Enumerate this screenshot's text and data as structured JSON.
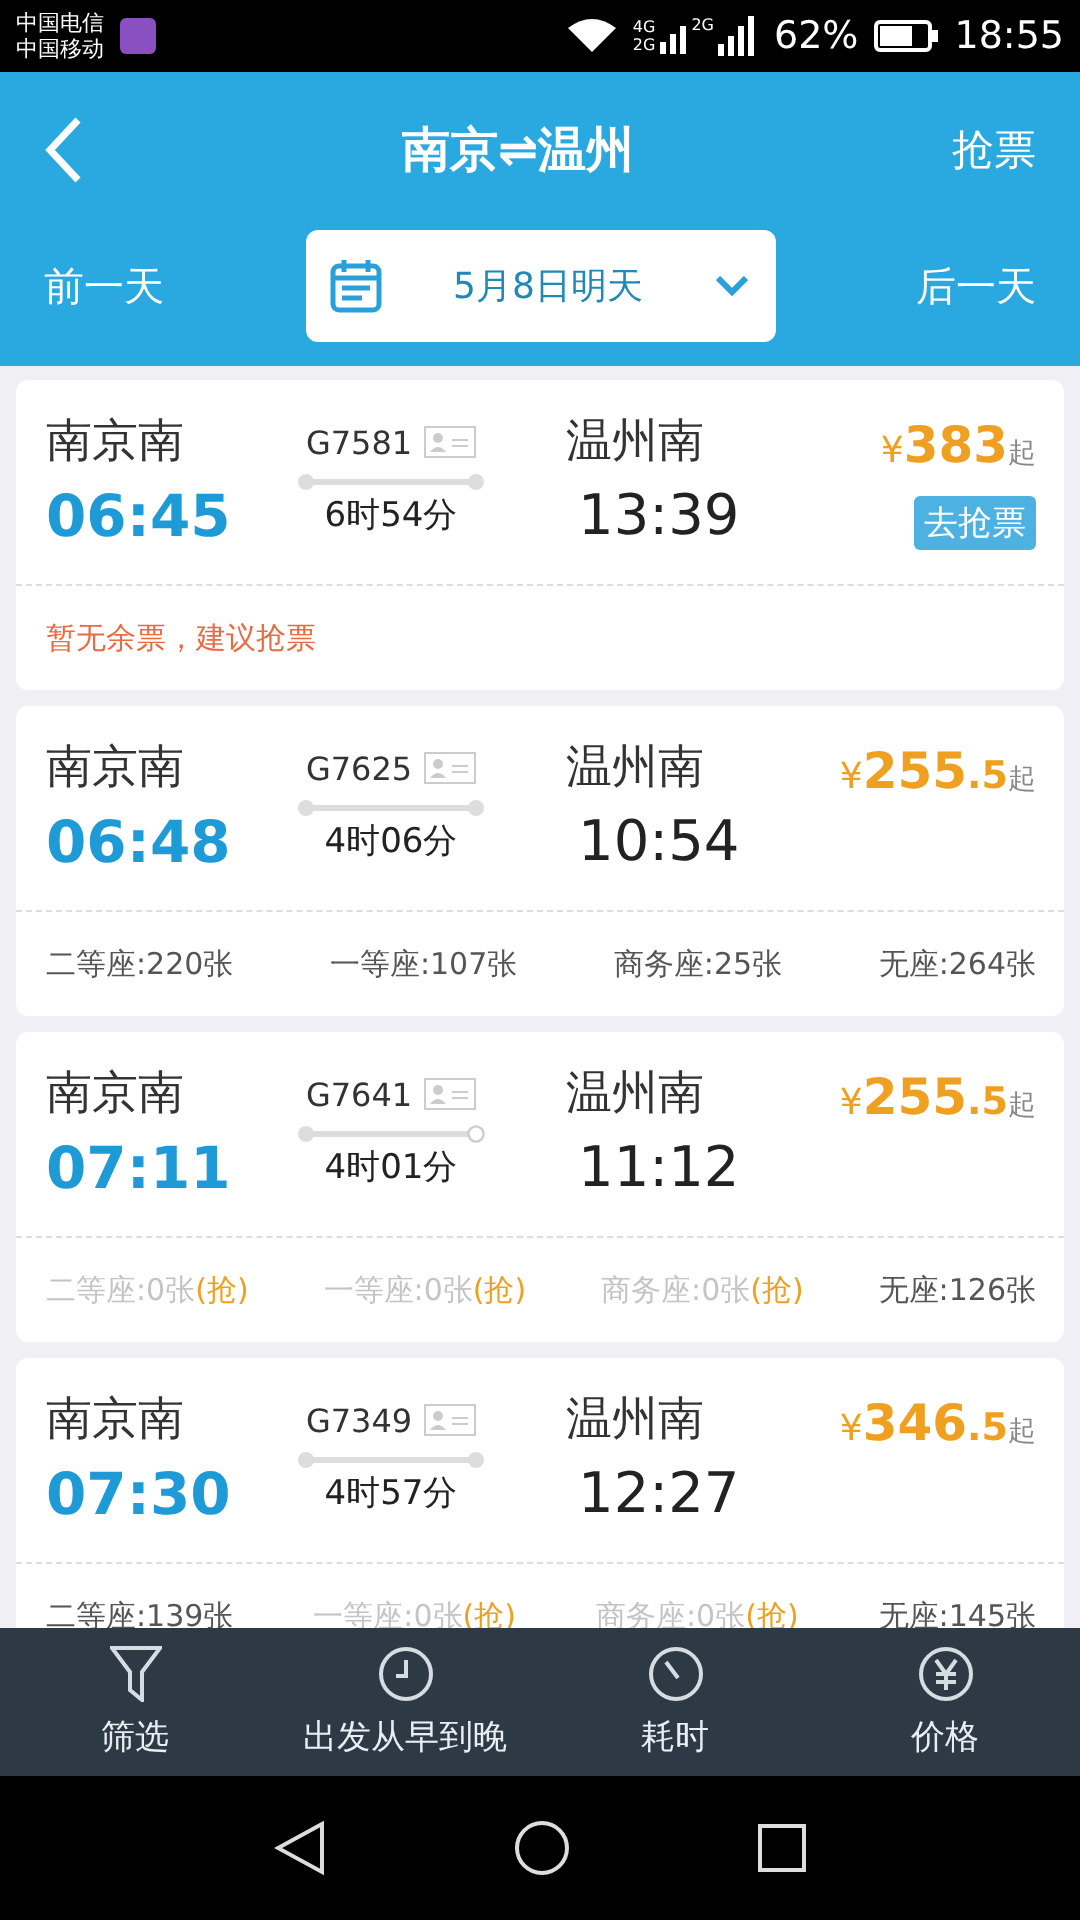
{
  "status_bar": {
    "carriers": [
      "中国电信",
      "中国移动"
    ],
    "network_labels": [
      "4G",
      "2G",
      "2G"
    ],
    "battery": "62%",
    "time": "18:55"
  },
  "header": {
    "title": "南京⇌温州",
    "action": "抢票",
    "prev_day": "前一天",
    "date": "5月8日明天",
    "next_day": "后一天"
  },
  "trains": [
    {
      "from": "南京南",
      "depart": "06:45",
      "number": "G7581",
      "duration": "6时54分",
      "to": "温州南",
      "arrive": "13:39",
      "currency": "¥",
      "price_int": "383",
      "price_suffix": "起",
      "grab_button": "去抢票",
      "notice": "暂无余票，建议抢票",
      "end_hollow": false
    },
    {
      "from": "南京南",
      "depart": "06:48",
      "number": "G7625",
      "duration": "4时06分",
      "to": "温州南",
      "arrive": "10:54",
      "currency": "¥",
      "price_int": "255",
      "price_dec": ".5",
      "price_suffix": "起",
      "end_hollow": false,
      "seats": [
        {
          "text": "二等座:220张",
          "available": true
        },
        {
          "text": "一等座:107张",
          "available": true
        },
        {
          "text": "商务座:25张",
          "available": true
        },
        {
          "text": "无座:264张",
          "available": true
        }
      ]
    },
    {
      "from": "南京南",
      "depart": "07:11",
      "number": "G7641",
      "duration": "4时01分",
      "to": "温州南",
      "arrive": "11:12",
      "currency": "¥",
      "price_int": "255",
      "price_dec": ".5",
      "price_suffix": "起",
      "end_hollow": true,
      "seats": [
        {
          "text": "二等座:0张",
          "grab": "(抢)",
          "available": false
        },
        {
          "text": "一等座:0张",
          "grab": "(抢)",
          "available": false
        },
        {
          "text": "商务座:0张",
          "grab": "(抢)",
          "available": false
        },
        {
          "text": "无座:126张",
          "available": true
        }
      ]
    },
    {
      "from": "南京南",
      "depart": "07:30",
      "number": "G7349",
      "duration": "4时57分",
      "to": "温州南",
      "arrive": "12:27",
      "currency": "¥",
      "price_int": "346",
      "price_dec": ".5",
      "price_suffix": "起",
      "end_hollow": false,
      "seats": [
        {
          "text": "二等座:139张",
          "available": true
        },
        {
          "text": "一等座:0张",
          "grab": "(抢)",
          "available": false
        },
        {
          "text": "商务座:0张",
          "grab": "(抢)",
          "available": false
        },
        {
          "text": "无座:145张",
          "available": true
        }
      ]
    }
  ],
  "bottom_bar": [
    {
      "kind": "filter",
      "label": "筛选"
    },
    {
      "kind": "depart",
      "label": "出发从早到晚"
    },
    {
      "kind": "duration",
      "label": "耗时"
    },
    {
      "kind": "price",
      "label": "价格"
    }
  ]
}
